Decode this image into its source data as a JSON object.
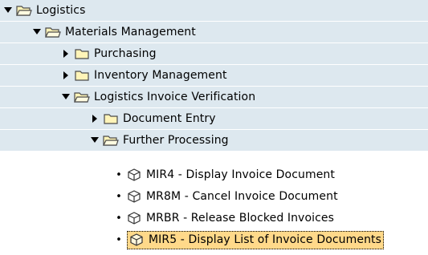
{
  "tree": {
    "root": {
      "label": "Logistics"
    },
    "mm": {
      "label": "Materials Management"
    },
    "purchasing": {
      "label": "Purchasing"
    },
    "inventory": {
      "label": "Inventory Management"
    },
    "liv": {
      "label": "Logistics Invoice Verification"
    },
    "doc_entry": {
      "label": "Document Entry"
    },
    "further": {
      "label": "Further Processing"
    },
    "transactions": [
      {
        "label": "MIR4 - Display Invoice Document"
      },
      {
        "label": "MR8M - Cancel Invoice Document"
      },
      {
        "label": "MRBR - Release Blocked Invoices"
      },
      {
        "label": "MIR5 - Display List of Invoice Documents"
      }
    ],
    "selected_index": 3
  },
  "colors": {
    "row_shaded": "#dde8ef",
    "folder_fill": "#fff4b8",
    "folder_stroke": "#4a4a4a",
    "selection": "#ffd98a"
  }
}
